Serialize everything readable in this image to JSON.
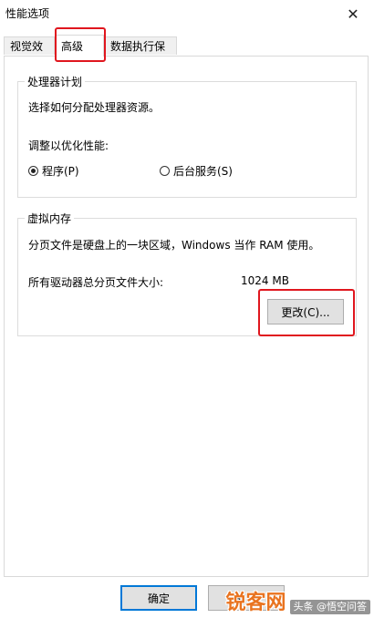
{
  "window": {
    "title": "性能选项",
    "close_glyph": "✕"
  },
  "tabs": [
    {
      "label": "视觉效果",
      "active": false
    },
    {
      "label": "高级",
      "active": true
    },
    {
      "label": "数据执行保护",
      "active": false
    }
  ],
  "processor": {
    "group_title": "处理器计划",
    "description": "选择如何分配处理器资源。",
    "adjust_label": "调整以优化性能:",
    "options": [
      {
        "label": "程序(P)",
        "selected": true
      },
      {
        "label": "后台服务(S)",
        "selected": false
      }
    ]
  },
  "virtual_memory": {
    "group_title": "虚拟内存",
    "description": "分页文件是硬盘上的一块区域，Windows 当作 RAM 使用。",
    "total_label": "所有驱动器总分页文件大小:",
    "total_value": "1024 MB",
    "change_button": "更改(C)..."
  },
  "footer": {
    "ok_button": "确定",
    "cancel_button": "取消"
  },
  "watermark": {
    "main": "锐客网",
    "sub": "头条 @悟空问答"
  },
  "colors": {
    "highlight": "#e0161e",
    "default_button_border": "#0078d7",
    "watermark": "#e9731f"
  }
}
